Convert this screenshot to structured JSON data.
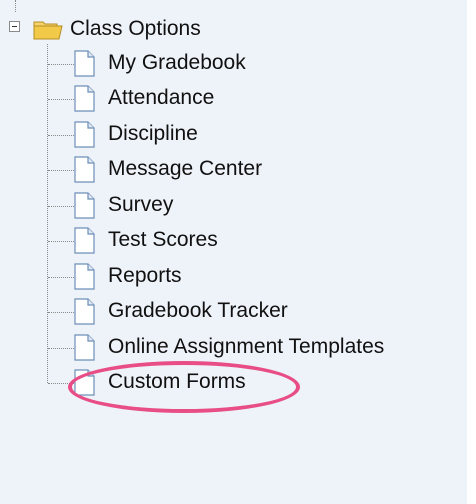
{
  "tree": {
    "root": {
      "label": "Class Options",
      "expanded": true,
      "icon": "folder-icon"
    },
    "items": [
      {
        "label": "My Gradebook",
        "icon": "document-icon"
      },
      {
        "label": "Attendance",
        "icon": "document-icon"
      },
      {
        "label": "Discipline",
        "icon": "document-icon"
      },
      {
        "label": "Message Center",
        "icon": "document-icon"
      },
      {
        "label": "Survey",
        "icon": "document-icon"
      },
      {
        "label": "Test Scores",
        "icon": "document-icon"
      },
      {
        "label": "Reports",
        "icon": "document-icon"
      },
      {
        "label": "Gradebook Tracker",
        "icon": "document-icon"
      },
      {
        "label": "Online Assignment Templates",
        "icon": "document-icon"
      },
      {
        "label": "Custom Forms",
        "icon": "document-icon",
        "highlighted": true
      }
    ]
  },
  "colors": {
    "panel_background": "#eef2f9",
    "highlight_ellipse": "#e84d86",
    "folder": "#f3c94a"
  }
}
